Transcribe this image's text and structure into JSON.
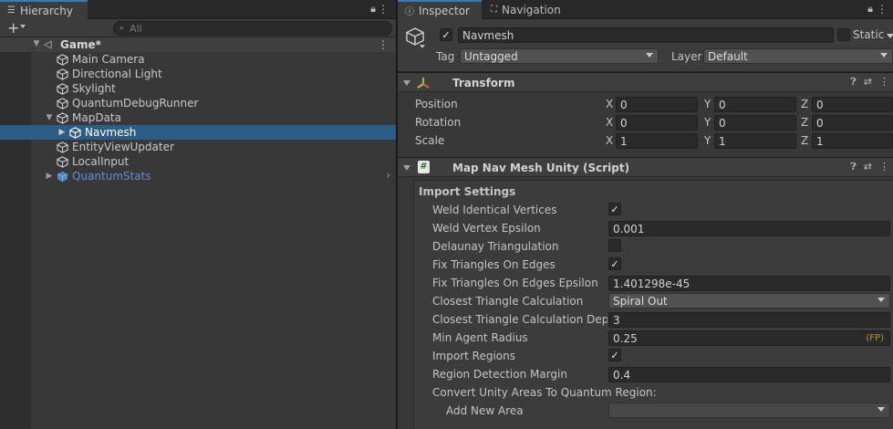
{
  "hierarchy": {
    "tab_label": "Hierarchy",
    "search_placeholder": "All",
    "scene_name": "Game*",
    "items": [
      {
        "label": "Main Camera"
      },
      {
        "label": "Directional Light"
      },
      {
        "label": "Skylight"
      },
      {
        "label": "QuantumDebugRunner"
      },
      {
        "label": "MapData"
      },
      {
        "label": "Navmesh"
      },
      {
        "label": "EntityViewUpdater"
      },
      {
        "label": "LocalInput"
      },
      {
        "label": "QuantumStats"
      }
    ]
  },
  "inspector": {
    "tabs": {
      "inspector": "Inspector",
      "navigation": "Navigation"
    },
    "object": {
      "name": "Navmesh",
      "active": true,
      "static_label": "Static",
      "tag_label": "Tag",
      "tag_value": "Untagged",
      "layer_label": "Layer",
      "layer_value": "Default"
    },
    "transform": {
      "title": "Transform",
      "position_label": "Position",
      "rotation_label": "Rotation",
      "scale_label": "Scale",
      "axis_x": "X",
      "axis_y": "Y",
      "axis_z": "Z",
      "position": [
        "0",
        "0",
        "0"
      ],
      "rotation": [
        "0",
        "0",
        "0"
      ],
      "scale": [
        "1",
        "1",
        "1"
      ]
    },
    "component": {
      "title": "Map Nav Mesh Unity (Script)",
      "section": "Import Settings",
      "weld_identical_vertices_label": "Weld Identical Vertices",
      "weld_identical_vertices": true,
      "weld_vertex_epsilon_label": "Weld Vertex Epsilon",
      "weld_vertex_epsilon": "0.001",
      "delaunay_label": "Delaunay Triangulation",
      "delaunay": false,
      "fix_triangles_label": "Fix Triangles On Edges",
      "fix_triangles": true,
      "fix_epsilon_label": "Fix Triangles On Edges Epsilon",
      "fix_epsilon": "1.401298e-45",
      "closest_calc_label": "Closest Triangle Calculation",
      "closest_calc": "Spiral Out",
      "closest_depth_label": "Closest Triangle Calculation Depth",
      "closest_depth": "3",
      "min_agent_radius_label": "Min Agent Radius",
      "min_agent_radius": "0.25",
      "fp_badge": "(FP)",
      "import_regions_label": "Import Regions",
      "import_regions": true,
      "region_margin_label": "Region Detection Margin",
      "region_margin": "0.4",
      "convert_areas_label": "Convert Unity Areas To Quantum Region:",
      "add_new_area_label": "Add New Area",
      "add_new_area_value": ""
    }
  },
  "colors": {
    "selection": "#2c5d87",
    "prefab_text": "#5c8fd6",
    "tab_accent": "#3a79bb",
    "fp_badge": "#b09b2d"
  }
}
